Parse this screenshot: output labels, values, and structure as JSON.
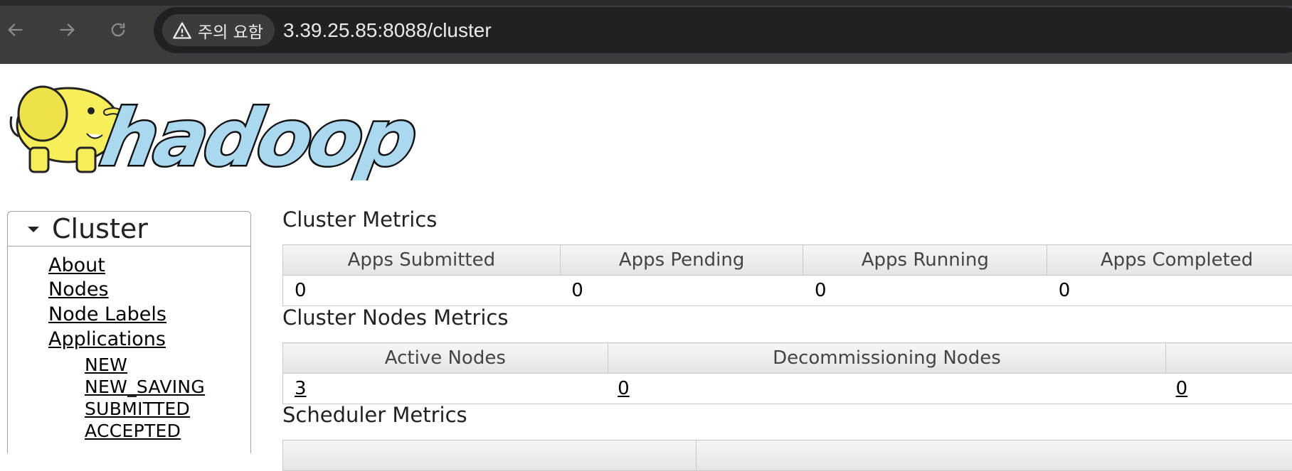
{
  "browser": {
    "warning_label": "주의 요함",
    "url": "3.39.25.85:8088/cluster"
  },
  "logo": {
    "text": "hadoop"
  },
  "sidebar": {
    "title": "Cluster",
    "links": [
      {
        "label": "About"
      },
      {
        "label": "Nodes"
      },
      {
        "label": "Node Labels"
      },
      {
        "label": "Applications"
      }
    ],
    "app_states": [
      {
        "label": "NEW"
      },
      {
        "label": "NEW_SAVING"
      },
      {
        "label": "SUBMITTED"
      },
      {
        "label": "ACCEPTED"
      }
    ]
  },
  "cluster_metrics": {
    "title": "Cluster Metrics",
    "headers": [
      "Apps Submitted",
      "Apps Pending",
      "Apps Running",
      "Apps Completed"
    ],
    "values": [
      "0",
      "0",
      "0",
      "0"
    ]
  },
  "cluster_nodes_metrics": {
    "title": "Cluster Nodes Metrics",
    "headers": [
      "Active Nodes",
      "Decommissioning Nodes",
      ""
    ],
    "values": [
      "3",
      "0",
      "0"
    ]
  },
  "scheduler_metrics": {
    "title": "Scheduler Metrics"
  },
  "colors": {
    "chrome_bg": "#3c3c3c",
    "urlbar_bg": "#202124",
    "logo_yellow": "#f6ee5a",
    "logo_blue": "#a9d8ef"
  }
}
